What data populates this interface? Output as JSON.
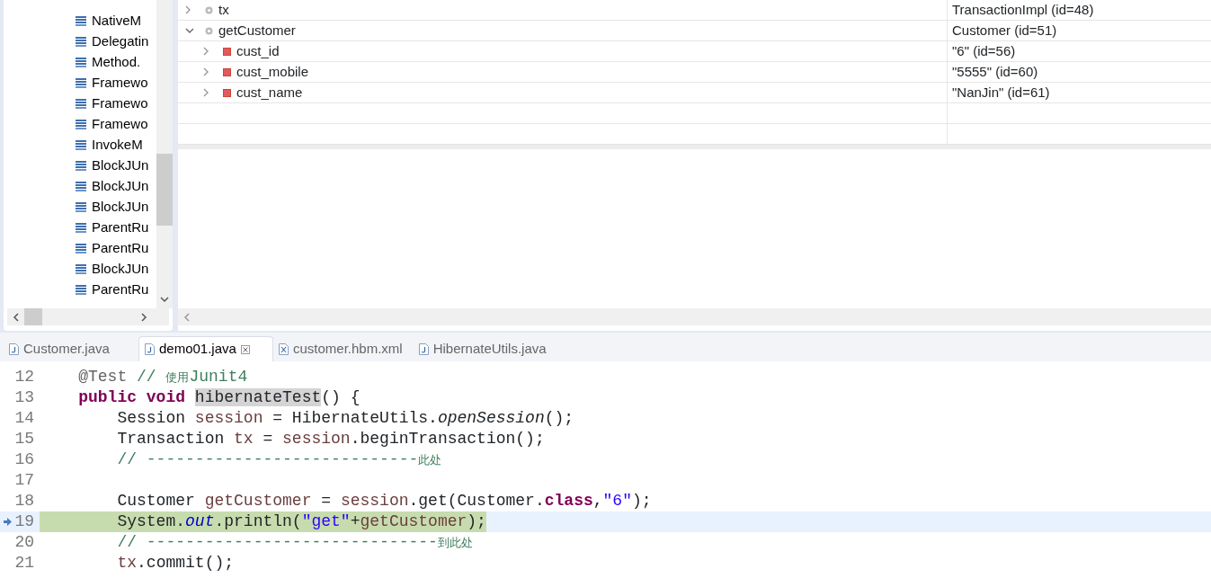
{
  "call_stack": {
    "items": [
      "NativeM",
      "Delegatin",
      "Method.",
      "Framewo",
      "Framewo",
      "Framewo",
      "InvokeM",
      "BlockJUn",
      "BlockJUn",
      "BlockJUn",
      "ParentRu",
      "ParentRu",
      "BlockJUn",
      "ParentRu"
    ]
  },
  "variables": {
    "rows": [
      {
        "name": "tx",
        "value": "TransactionImpl  (id=48)",
        "kind": "local",
        "expanded": false
      },
      {
        "name": "getCustomer",
        "value": "Customer  (id=51)",
        "kind": "local",
        "expanded": true,
        "children": [
          {
            "name": "cust_id",
            "value": "\"6\" (id=56)",
            "kind": "field",
            "expanded": false
          },
          {
            "name": "cust_mobile",
            "value": "\"5555\" (id=60)",
            "kind": "field",
            "expanded": false
          },
          {
            "name": "cust_name",
            "value": "\"NanJin\" (id=61)",
            "kind": "field",
            "expanded": false
          }
        ]
      }
    ]
  },
  "editor": {
    "tabs": [
      {
        "label": "Customer.java",
        "kind": "java",
        "selected": false
      },
      {
        "label": "demo01.java",
        "kind": "java",
        "selected": true
      },
      {
        "label": "customer.hbm.xml",
        "kind": "xml",
        "selected": false
      },
      {
        "label": "HibernateUtils.java",
        "kind": "java",
        "selected": false
      }
    ],
    "lines": [
      {
        "number": "12",
        "current": false,
        "tokens": [
          {
            "text": "    @Test",
            "kind": "annotation"
          },
          {
            "text": " // 使用Junit4",
            "kind": "comment"
          }
        ]
      },
      {
        "number": "13",
        "current": false,
        "tokens": [
          {
            "text": "    public void ",
            "kind": "keyword"
          },
          {
            "text": "hibernateTest",
            "kind": "occurrence"
          },
          {
            "text": "() {",
            "kind": "plain"
          }
        ]
      },
      {
        "number": "14",
        "current": false,
        "tokens": [
          {
            "text": "        Session ",
            "kind": "plain"
          },
          {
            "text": "session",
            "kind": "local"
          },
          {
            "text": " = HibernateUtils.",
            "kind": "plain"
          },
          {
            "text": "openSession",
            "kind": "static"
          },
          {
            "text": "();",
            "kind": "plain"
          }
        ]
      },
      {
        "number": "15",
        "current": false,
        "tokens": [
          {
            "text": "        Transaction ",
            "kind": "plain"
          },
          {
            "text": "tx",
            "kind": "local"
          },
          {
            "text": " = ",
            "kind": "plain"
          },
          {
            "text": "session",
            "kind": "local"
          },
          {
            "text": ".beginTransaction();",
            "kind": "plain"
          }
        ]
      },
      {
        "number": "16",
        "current": false,
        "tokens": [
          {
            "text": "        // ----------------------------此处",
            "kind": "comment"
          }
        ]
      },
      {
        "number": "17",
        "current": false
      },
      {
        "number": "18",
        "current": false,
        "tokens": [
          {
            "text": "        Customer ",
            "kind": "plain"
          },
          {
            "text": "getCustomer",
            "kind": "local"
          },
          {
            "text": " = ",
            "kind": "plain"
          },
          {
            "text": "session",
            "kind": "local"
          },
          {
            "text": ".get(Customer.",
            "kind": "plain"
          },
          {
            "text": "class",
            "kind": "keyword"
          },
          {
            "text": ",",
            "kind": "plain"
          },
          {
            "text": "\"6\"",
            "kind": "string"
          },
          {
            "text": ");",
            "kind": "plain"
          }
        ]
      },
      {
        "number": "19",
        "current": true,
        "tokens": [
          {
            "text": "        System.",
            "kind": "plain"
          },
          {
            "text": "out",
            "kind": "field"
          },
          {
            "text": ".println(",
            "kind": "plain"
          },
          {
            "text": "\"get\"",
            "kind": "string"
          },
          {
            "text": "+",
            "kind": "plain"
          },
          {
            "text": "getCustomer",
            "kind": "local"
          },
          {
            "text": ");",
            "kind": "plain"
          }
        ]
      },
      {
        "number": "20",
        "current": false,
        "tokens": [
          {
            "text": "        // ------------------------------到此处",
            "kind": "comment"
          }
        ]
      },
      {
        "number": "21",
        "current": false,
        "tokens": [
          {
            "text": "        tx",
            "kind": "local"
          },
          {
            "text": ".commit();",
            "kind": "plain"
          }
        ]
      }
    ]
  }
}
